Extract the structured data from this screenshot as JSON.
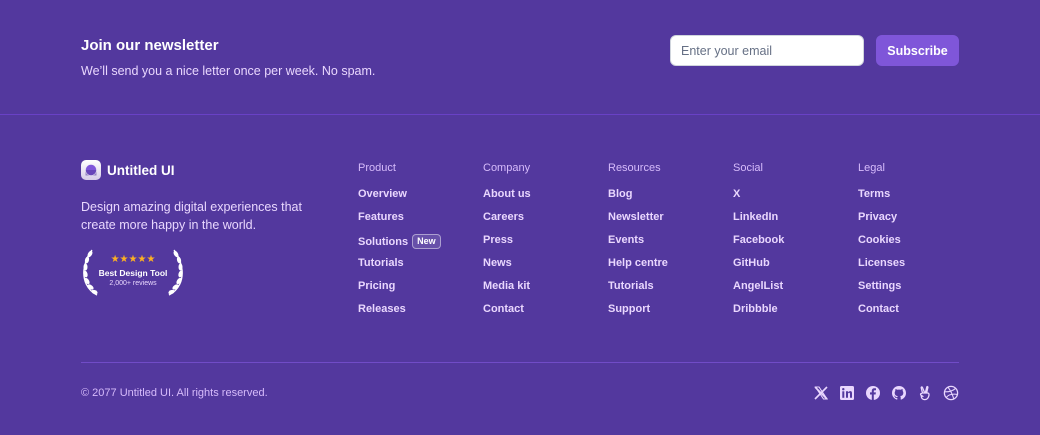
{
  "newsletter": {
    "title": "Join our newsletter",
    "subtitle": "We’ll send you a nice letter once per week. No spam.",
    "email_placeholder": "Enter your email",
    "subscribe_label": "Subscribe"
  },
  "brand": {
    "name": "Untitled UI",
    "tagline": "Design amazing digital experiences that create more happy in the world."
  },
  "badge": {
    "stars": "★★★★★",
    "title": "Best Design Tool",
    "subtitle": "2,000+ reviews"
  },
  "columns": [
    {
      "heading": "Product",
      "links": [
        "Overview",
        "Features",
        "Solutions",
        "Tutorials",
        "Pricing",
        "Releases"
      ]
    },
    {
      "heading": "Company",
      "links": [
        "About us",
        "Careers",
        "Press",
        "News",
        "Media kit",
        "Contact"
      ]
    },
    {
      "heading": "Resources",
      "links": [
        "Blog",
        "Newsletter",
        "Events",
        "Help centre",
        "Tutorials",
        "Support"
      ]
    },
    {
      "heading": "Social",
      "links": [
        "X",
        "LinkedIn",
        "Facebook",
        "GitHub",
        "AngelList",
        "Dribbble"
      ]
    },
    {
      "heading": "Legal",
      "links": [
        "Terms",
        "Privacy",
        "Cookies",
        "Licenses",
        "Settings",
        "Contact"
      ]
    }
  ],
  "solutions_tag": "New",
  "copyright": "© 2077 Untitled UI. All rights reserved.",
  "social_icons": [
    "x-icon",
    "linkedin-icon",
    "facebook-icon",
    "github-icon",
    "angellist-icon",
    "dribbble-icon"
  ],
  "colors": {
    "background": "#53389e",
    "accent": "#7f56d9",
    "star": "#fdb022"
  }
}
